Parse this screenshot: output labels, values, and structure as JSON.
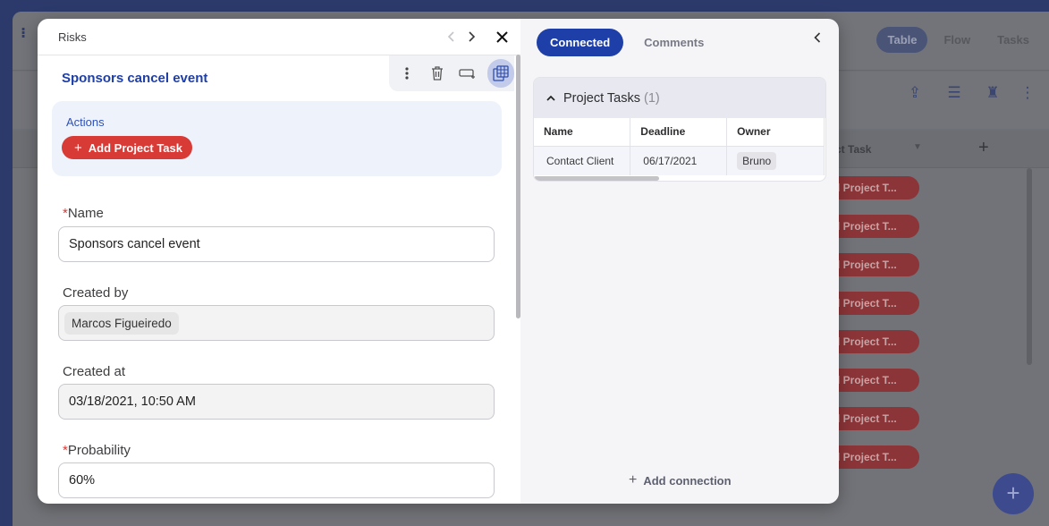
{
  "background": {
    "view_tabs": [
      "Table",
      "Flow",
      "Tasks"
    ],
    "column_header": "ject Task",
    "pill_label": "d Project T...",
    "pill_count": 8,
    "fab_label": "+"
  },
  "modal": {
    "header": {
      "title": "Risks",
      "prev_icon": "chevron-left-icon",
      "next_icon": "chevron-right-icon",
      "close_icon": "close-icon"
    },
    "record_title": "Sponsors cancel event",
    "actions": {
      "label": "Actions",
      "add_button": "Add Project Task"
    },
    "fields": {
      "name": {
        "label": "Name",
        "value": "Sponsors cancel event",
        "required": "*"
      },
      "created_by": {
        "label": "Created by",
        "value": "Marcos Figueiredo"
      },
      "created_at": {
        "label": "Created at",
        "value": "03/18/2021, 10:50 AM"
      },
      "probability": {
        "label": "Probability",
        "value": "60%",
        "required": "*"
      }
    },
    "right": {
      "tabs": [
        "Connected",
        "Comments"
      ],
      "project_tasks": {
        "title": "Project Tasks",
        "count": "(1)",
        "columns": [
          "Name",
          "Deadline",
          "Owner"
        ],
        "rows": [
          {
            "name": "Contact Client",
            "deadline": "06/17/2021",
            "owner": "Bruno"
          }
        ]
      },
      "add_connection": "Add connection"
    }
  }
}
